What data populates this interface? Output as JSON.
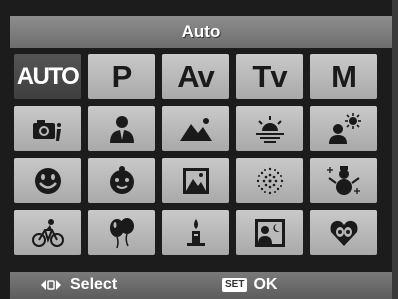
{
  "title": "Auto",
  "modes_row1": [
    "AUTO",
    "P",
    "Av",
    "Tv",
    "M"
  ],
  "scene_icons": [
    [
      "camera-info-icon",
      "portrait-icon",
      "landscape-icon",
      "sunset-icon",
      "night-portrait-icon"
    ],
    [
      "smile-icon",
      "baby-icon",
      "photo-frame-icon",
      "fireworks-icon",
      "snow-icon"
    ],
    [
      "bicycle-sports-icon",
      "balloons-party-icon",
      "candlelight-icon",
      "night-scene-icon",
      "pet-icon"
    ]
  ],
  "selected": "AUTO",
  "footer": {
    "select_label": "Select",
    "set_badge": "SET",
    "ok_label": "OK"
  },
  "colors": {
    "tile": "#b9b9b9",
    "tile_selected": "#4a4a4a",
    "title_bar": "#7e7e7e"
  }
}
